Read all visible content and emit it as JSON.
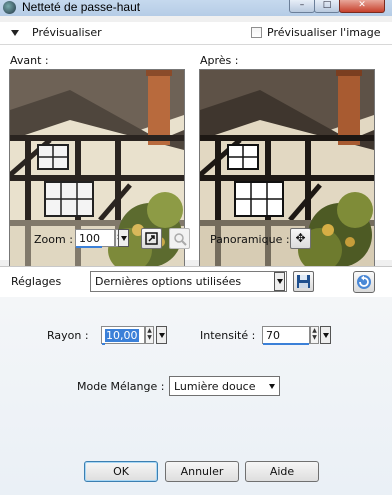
{
  "window": {
    "title": "Netteté de passe-haut",
    "min_glyph": "–",
    "max_glyph": "□",
    "close_glyph": "✕"
  },
  "preview": {
    "label": "Prévisualiser",
    "checkbox_label": "Prévisualiser l'image",
    "checkbox_checked": false,
    "before_label": "Avant :",
    "after_label": "Après :"
  },
  "zoom": {
    "label": "Zoom :",
    "value": "100"
  },
  "pan": {
    "label": "Panoramique :"
  },
  "presets": {
    "label": "Réglages",
    "value": "Dernières options utilisées"
  },
  "params": {
    "radius": {
      "label": "Rayon :",
      "value": "10,00"
    },
    "intensity": {
      "label": "Intensité :",
      "value": "70"
    },
    "blend": {
      "label": "Mode Mélange :",
      "value": "Lumière douce"
    }
  },
  "buttons": {
    "ok": "OK",
    "cancel": "Annuler",
    "help": "Aide"
  },
  "colors": {
    "accent": "#3b80d8",
    "title_bar": "#c6d9ee",
    "close": "#c7412c"
  },
  "icons": [
    "app-icon",
    "collapse-triangle-icon",
    "fit-window-icon",
    "zoom-actual-icon",
    "pan-move-icon",
    "save-icon",
    "reset-icon",
    "spin-arrows-icon",
    "dropdown-arrow-icon"
  ]
}
